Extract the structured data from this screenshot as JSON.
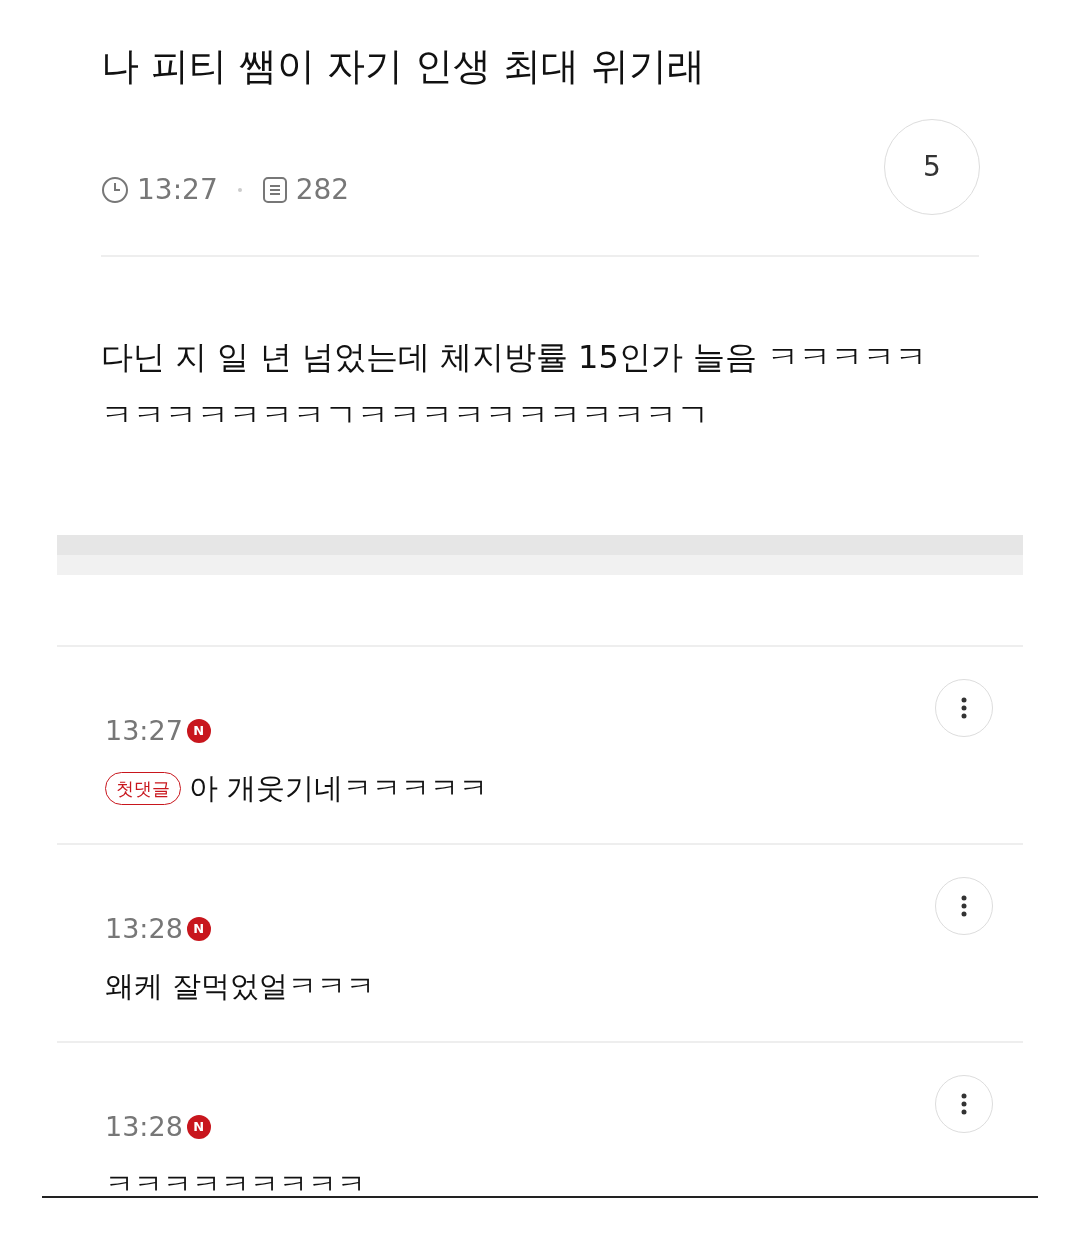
{
  "post": {
    "title": "나 피티 쌤이 자기 인생 최대 위기래",
    "time": "13:27",
    "views": "282",
    "comment_count": "5",
    "body": "다닌 지 일 년 넘었는데 체지방률 15인가 늘음 ㅋㅋㅋㅋㅋㅋㅋㅋㅋㅋㅋㅋㄱㅋㅋㅋㅋㅋㅋㅋㅋㅋㅋㄱ"
  },
  "comments": [
    {
      "time": "13:27",
      "badge": "N",
      "tag": "첫댓글",
      "text": "아 개웃기네ㅋㅋㅋㅋㅋ"
    },
    {
      "time": "13:28",
      "badge": "N",
      "text": "왜케 잘먹었얼ㅋㅋㅋ"
    },
    {
      "time": "13:28",
      "badge": "N",
      "text": "ㅋㅋㅋㅋㅋㅋㅋㅋㅋ"
    }
  ]
}
